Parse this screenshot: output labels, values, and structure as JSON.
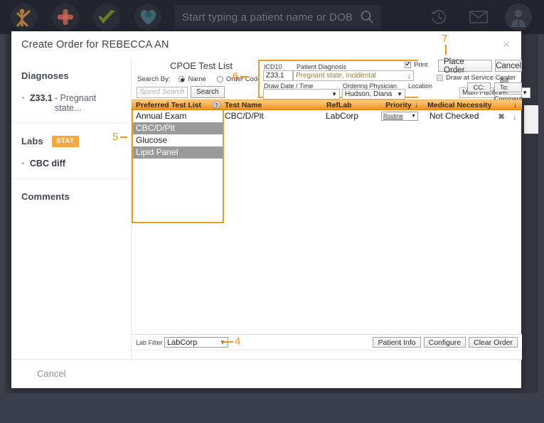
{
  "topbar": {
    "icons": [
      "person-logo-icon",
      "first-aid-icon",
      "checkmark-icon",
      "heart-icon"
    ],
    "search": {
      "placeholder": "Start typing a patient name or DOB",
      "value": ""
    },
    "right_icons": [
      "history-icon",
      "mail-icon",
      "user-avatar-icon"
    ]
  },
  "modal": {
    "title": "Create Order for REBECCA AN",
    "close_label": "×",
    "footer_cancel": "Cancel"
  },
  "sidebar": {
    "diagnoses": {
      "title": "Diagnoses",
      "items": [
        {
          "code": "Z33.1",
          "desc": "- Pregnant state..."
        }
      ]
    },
    "labs": {
      "title": "Labs",
      "badge": "STAT",
      "items": [
        {
          "code": "CBC diff",
          "desc": ""
        }
      ]
    },
    "comments": {
      "title": "Comments"
    }
  },
  "cpoe": {
    "title": "CPOE Test List",
    "search_by_label": "Search By:",
    "search_by_options": [
      "Name",
      "Order Code"
    ],
    "search_by_selected": "Name",
    "speed_search_placeholder": "Speed Search",
    "speed_search_value": "",
    "search_button": "Search"
  },
  "order_form": {
    "icd10_label": "ICD10",
    "icd10_value": "Z33.1",
    "patient_diagnosis_label": "Patient Diagnosis",
    "patient_diagnosis_value": "Pregnant state, incidental",
    "draw_datetime_label": "Draw Date / Time",
    "draw_datetime_value": "",
    "ordering_physician_label": "Ordering Physician",
    "ordering_physician_value": "Hudson, Diana",
    "location_label": "Location",
    "location_value": "Main Facility",
    "print_label": "Print",
    "print_checked": true,
    "draw_at_service_center_label": "Draw at Service Center",
    "draw_at_service_center_checked": false,
    "place_order_button": "Place Order",
    "cancel_button": "Cancel",
    "cc_button": "CC:",
    "bill_to_button": "Bill To: (T)",
    "comment_button": "Comment"
  },
  "table": {
    "headers": {
      "preferred_test_list": "Preferred Test List",
      "help_icon": "?",
      "test_name": "Test Name",
      "reflab": "RefLab",
      "priority": "Priority",
      "medical_necessity": "Medical Necessity",
      "sort_arrow": "↓"
    },
    "preferred_tests": [
      {
        "label": "Annual Exam",
        "selected": false
      },
      {
        "label": "CBC/D/Plt",
        "selected": true
      },
      {
        "label": "Glucose",
        "selected": false
      },
      {
        "label": "Lipid Panel",
        "selected": true
      }
    ],
    "rows": [
      {
        "test_name": "CBC/D/Plt",
        "reflab": "LabCorp",
        "priority": "Routine",
        "medical_necessity": "Not Checked",
        "remove_icon": "✖",
        "down_icon": "↓"
      }
    ]
  },
  "legacy_footer": {
    "lab_filter_label": "Lab Filter",
    "lab_filter_value": "LabCorp",
    "patient_info_button": "Patient Info",
    "configure_button": "Configure",
    "clear_order_button": "Clear Order"
  },
  "annotations": [
    {
      "id": "anno-4",
      "label": "4"
    },
    {
      "id": "anno-5",
      "label": "5"
    },
    {
      "id": "anno-6",
      "label": "6"
    },
    {
      "id": "anno-7",
      "label": "7"
    }
  ],
  "colors": {
    "accent_orange": "#f0911e",
    "header_gradient_top": "#fecf82",
    "header_gradient_bottom": "#f08f1c",
    "stat_badge": "#f5a93c",
    "chrome_dark": "#22242f",
    "body_dark": "#3c3f4c"
  }
}
